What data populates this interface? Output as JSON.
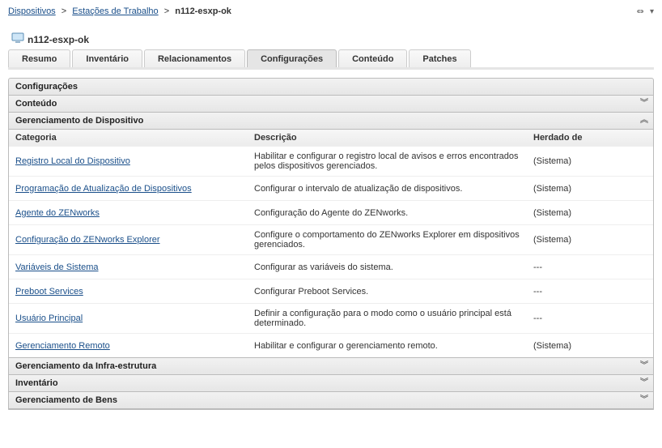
{
  "breadcrumb": {
    "items": [
      {
        "label": "Dispositivos"
      },
      {
        "label": "Estações de Trabalho"
      }
    ],
    "current": "n112-esxp-ok"
  },
  "title": "n112-esxp-ok",
  "tabs": [
    {
      "label": "Resumo"
    },
    {
      "label": "Inventário"
    },
    {
      "label": "Relacionamentos"
    },
    {
      "label": "Configurações"
    },
    {
      "label": "Conteúdo"
    },
    {
      "label": "Patches"
    }
  ],
  "active_tab": 3,
  "sections": {
    "config": "Configurações",
    "conteudo": "Conteúdo",
    "ger_disp": "Gerenciamento de Dispositivo",
    "infra": "Gerenciamento da Infra-estrutura",
    "inventario": "Inventário",
    "bens": "Gerenciamento de Bens"
  },
  "columns": {
    "categoria": "Categoria",
    "descricao": "Descrição",
    "herdado": "Herdado de"
  },
  "rows": [
    {
      "cat": "Registro Local do Dispositivo",
      "desc": "Habilitar e configurar o registro local de avisos e erros encontrados pelos dispositivos gerenciados.",
      "her": "(Sistema)"
    },
    {
      "cat": "Programação de Atualização de Dispositivos",
      "desc": "Configurar o intervalo de atualização de dispositivos.",
      "her": "(Sistema)"
    },
    {
      "cat": "Agente do ZENworks",
      "desc": "Configuração do Agente do ZENworks.",
      "her": "(Sistema)"
    },
    {
      "cat": "Configuração do ZENworks Explorer",
      "desc": "Configure o comportamento do ZENworks Explorer em dispositivos gerenciados.",
      "her": "(Sistema)"
    },
    {
      "cat": "Variáveis de Sistema",
      "desc": "Configurar as variáveis do sistema.",
      "her": "---"
    },
    {
      "cat": "Preboot Services",
      "desc": "Configurar Preboot Services.",
      "her": "---"
    },
    {
      "cat": "Usuário Principal",
      "desc": "Definir a configuração para o modo como o usuário principal está determinado.",
      "her": "---"
    },
    {
      "cat": "Gerenciamento Remoto",
      "desc": "Habilitar e configurar o gerenciamento remoto.",
      "her": "(Sistema)"
    }
  ]
}
